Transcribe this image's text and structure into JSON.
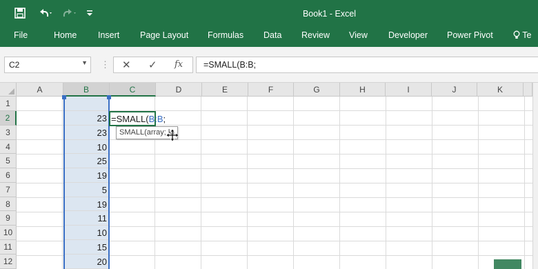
{
  "quick_access": {
    "save_icon": "save-icon",
    "undo_icon": "undo-icon",
    "redo_icon": "redo-icon",
    "customize_icon": "customize-qat-icon"
  },
  "window": {
    "title": "Book1 - Excel"
  },
  "ribbon": {
    "tabs": [
      "File",
      "Home",
      "Insert",
      "Page Layout",
      "Formulas",
      "Data",
      "Review",
      "View",
      "Developer",
      "Power Pivot"
    ],
    "tell_me": "Te",
    "tell_me_icon": "lightbulb-icon"
  },
  "formula_bar": {
    "name_box": "C2",
    "cancel_symbol": "✕",
    "enter_symbol": "✓",
    "fx_symbol": "fx",
    "formula": "=SMALL(B:B;"
  },
  "sheet": {
    "columns": [
      "A",
      "B",
      "C",
      "D",
      "E",
      "F",
      "G",
      "H",
      "I",
      "J",
      "K"
    ],
    "rows": [
      "1",
      "2",
      "3",
      "4",
      "5",
      "6",
      "7",
      "8",
      "9",
      "10",
      "11",
      "12"
    ],
    "column_b_values": [
      "",
      "23",
      "23",
      "10",
      "25",
      "19",
      "5",
      "19",
      "11",
      "10",
      "15",
      "20"
    ],
    "active_cell": {
      "ref": "C2",
      "formula_prefix": "=SMALL(",
      "formula_ref": "B:B",
      "formula_suffix": ";"
    },
    "tooltip": "SMALL(array; k)",
    "accent_color": "#217346",
    "selection_color": "#3a6fc4"
  }
}
